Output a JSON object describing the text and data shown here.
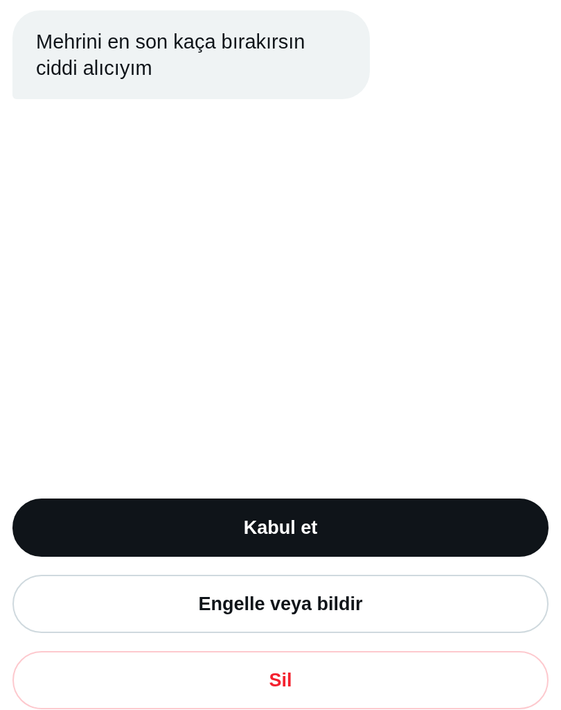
{
  "message": {
    "text": "Mehrini en son kaça bırakırsın ciddi alıcıyım"
  },
  "actions": [
    {
      "kind": "primary",
      "label": "Kabul et"
    },
    {
      "kind": "secondary",
      "label": "Engelle veya bildir"
    },
    {
      "kind": "danger",
      "label": "Sil"
    }
  ]
}
